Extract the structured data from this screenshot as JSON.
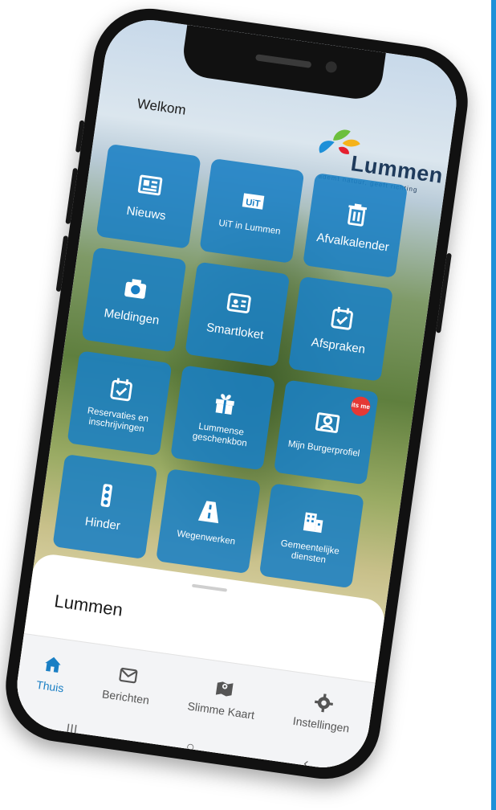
{
  "header": {
    "welcome": "Welkom"
  },
  "logo": {
    "name": "Lummen",
    "tagline": "ademt natuur, geeft richting"
  },
  "tiles": [
    {
      "label": "Nieuws",
      "icon": "newspaper-icon"
    },
    {
      "label": "UiT in Lummen",
      "icon": "uit-logo-icon"
    },
    {
      "label": "Afvalkalender",
      "icon": "trash-icon"
    },
    {
      "label": "Meldingen",
      "icon": "camera-icon"
    },
    {
      "label": "Smartloket",
      "icon": "id-card-icon"
    },
    {
      "label": "Afspraken",
      "icon": "calendar-check-icon"
    },
    {
      "label": "Reservaties en inschrijvingen",
      "icon": "calendar-check-icon"
    },
    {
      "label": "Lummense geschenkbon",
      "icon": "gift-icon"
    },
    {
      "label": "Mijn Burgerprofiel",
      "icon": "profile-icon",
      "badge": "its me"
    },
    {
      "label": "Hinder",
      "icon": "traffic-light-icon"
    },
    {
      "label": "Wegenwerken",
      "icon": "road-icon"
    },
    {
      "label": "Gemeentelijke diensten",
      "icon": "building-icon"
    }
  ],
  "sheet": {
    "title": "Lummen"
  },
  "tabbar": {
    "items": [
      {
        "label": "Thuis",
        "icon": "home-icon",
        "active": true
      },
      {
        "label": "Berichten",
        "icon": "mail-icon"
      },
      {
        "label": "Slimme Kaart",
        "icon": "map-icon"
      },
      {
        "label": "Instellingen",
        "icon": "gear-icon"
      }
    ]
  },
  "sysnav": {
    "recents": "|||",
    "home": "○",
    "back": "‹"
  },
  "colors": {
    "tile": "#1a7fc4",
    "accent": "#1a7fc4",
    "border": "#1e90d8"
  }
}
